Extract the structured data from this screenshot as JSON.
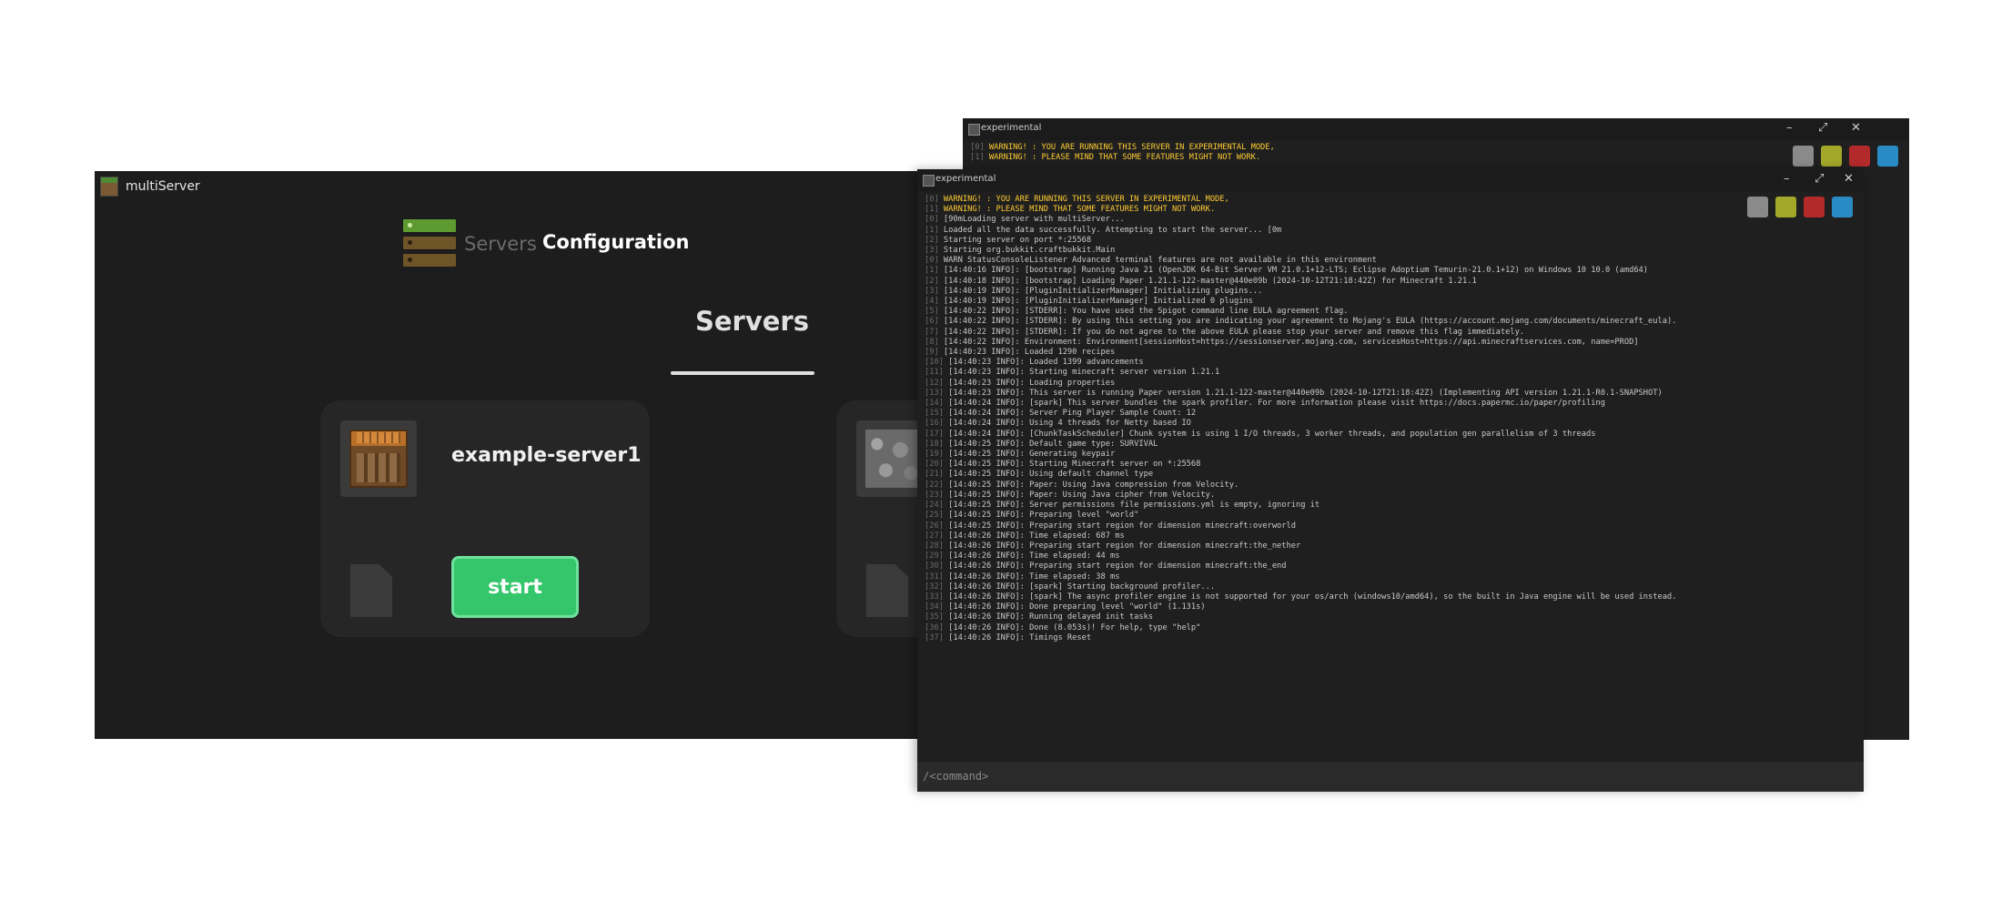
{
  "main_window": {
    "title": "multiServer",
    "nav": {
      "servers_label": "Servers",
      "configuration_label": "Configuration"
    },
    "section_title": "Servers",
    "servers": [
      {
        "name": "example-server1",
        "icon": "crafting-table-icon",
        "start_label": "start"
      },
      {
        "name": "",
        "icon": "cobblestone-icon"
      }
    ],
    "colors": {
      "accent_green": "#35c56b",
      "background": "#1d1d1d",
      "card": "#262626"
    }
  },
  "console_back": {
    "title": "experimental",
    "controls": {
      "minimize": "–",
      "maximize": "⤢",
      "close": "✕"
    },
    "swatches": [
      "#8a8a8a",
      "#a3a82a",
      "#b32a2a",
      "#2a8bc4"
    ],
    "lines": [
      {
        "idx": "[0]",
        "text": " WARNING! : YOU ARE RUNNING THIS SERVER IN EXPERIMENTAL MODE,",
        "warn": true
      },
      {
        "idx": "[1]",
        "text": " WARNING! : PLEASE MIND THAT SOME FEATURES MIGHT NOT WORK.",
        "warn": true
      }
    ]
  },
  "console_front": {
    "title": "experimental",
    "controls": {
      "minimize": "–",
      "maximize": "⤢",
      "close": "✕"
    },
    "swatches": [
      "#8a8a8a",
      "#a3a82a",
      "#b32a2a",
      "#2a8bc4"
    ],
    "command_placeholder": "/<command>",
    "lines": [
      {
        "idx": "[0]",
        "text": " WARNING! : YOU ARE RUNNING THIS SERVER IN EXPERIMENTAL MODE,",
        "warn": true
      },
      {
        "idx": "[1]",
        "text": " WARNING! : PLEASE MIND THAT SOME FEATURES MIGHT NOT WORK.",
        "warn": true
      },
      {
        "idx": "[0]",
        "text": " [90mLoading server with multiServer..."
      },
      {
        "idx": "[1]",
        "text": " Loaded all the data successfully. Attempting to start the server... [0m"
      },
      {
        "idx": "[2]",
        "text": " Starting server on port *:25568"
      },
      {
        "idx": "[3]",
        "text": " Starting org.bukkit.craftbukkit.Main"
      },
      {
        "idx": "[0]",
        "text": " WARN StatusConsoleListener Advanced terminal features are not available in this environment"
      },
      {
        "idx": "[1]",
        "text": " [14:40:16 INFO]: [bootstrap] Running Java 21 (OpenJDK 64-Bit Server VM 21.0.1+12-LTS; Eclipse Adoptium Temurin-21.0.1+12) on Windows 10 10.0 (amd64)"
      },
      {
        "idx": "[2]",
        "text": " [14:40:18 INFO]: [bootstrap] Loading Paper 1.21.1-122-master@440e09b (2024-10-12T21:18:42Z) for Minecraft 1.21.1"
      },
      {
        "idx": "[3]",
        "text": " [14:40:19 INFO]: [PluginInitializerManager] Initializing plugins..."
      },
      {
        "idx": "[4]",
        "text": " [14:40:19 INFO]: [PluginInitializerManager] Initialized 0 plugins"
      },
      {
        "idx": "[5]",
        "text": " [14:40:22 INFO]: [STDERR]: You have used the Spigot command line EULA agreement flag."
      },
      {
        "idx": "[6]",
        "text": " [14:40:22 INFO]: [STDERR]: By using this setting you are indicating your agreement to Mojang's EULA (https://account.mojang.com/documents/minecraft_eula)."
      },
      {
        "idx": "[7]",
        "text": " [14:40:22 INFO]: [STDERR]: If you do not agree to the above EULA please stop your server and remove this flag immediately."
      },
      {
        "idx": "[8]",
        "text": " [14:40:22 INFO]: Environment: Environment[sessionHost=https://sessionserver.mojang.com, servicesHost=https://api.minecraftservices.com, name=PROD]"
      },
      {
        "idx": "[9]",
        "text": " [14:40:23 INFO]: Loaded 1290 recipes"
      },
      {
        "idx": "[10]",
        "text": " [14:40:23 INFO]: Loaded 1399 advancements"
      },
      {
        "idx": "[11]",
        "text": " [14:40:23 INFO]: Starting minecraft server version 1.21.1"
      },
      {
        "idx": "[12]",
        "text": " [14:40:23 INFO]: Loading properties"
      },
      {
        "idx": "[13]",
        "text": " [14:40:23 INFO]: This server is running Paper version 1.21.1-122-master@440e09b (2024-10-12T21:18:42Z) (Implementing API version 1.21.1-R0.1-SNAPSHOT)"
      },
      {
        "idx": "[14]",
        "text": " [14:40:24 INFO]: [spark] This server bundles the spark profiler. For more information please visit https://docs.papermc.io/paper/profiling"
      },
      {
        "idx": "[15]",
        "text": " [14:40:24 INFO]: Server Ping Player Sample Count: 12"
      },
      {
        "idx": "[16]",
        "text": " [14:40:24 INFO]: Using 4 threads for Netty based IO"
      },
      {
        "idx": "[17]",
        "text": " [14:40:24 INFO]: [ChunkTaskScheduler] Chunk system is using 1 I/O threads, 3 worker threads, and population gen parallelism of 3 threads"
      },
      {
        "idx": "[18]",
        "text": " [14:40:25 INFO]: Default game type: SURVIVAL"
      },
      {
        "idx": "[19]",
        "text": " [14:40:25 INFO]: Generating keypair"
      },
      {
        "idx": "[20]",
        "text": " [14:40:25 INFO]: Starting Minecraft server on *:25568"
      },
      {
        "idx": "[21]",
        "text": " [14:40:25 INFO]: Using default channel type"
      },
      {
        "idx": "[22]",
        "text": " [14:40:25 INFO]: Paper: Using Java compression from Velocity."
      },
      {
        "idx": "[23]",
        "text": " [14:40:25 INFO]: Paper: Using Java cipher from Velocity."
      },
      {
        "idx": "[24]",
        "text": " [14:40:25 INFO]: Server permissions file permissions.yml is empty, ignoring it"
      },
      {
        "idx": "[25]",
        "text": " [14:40:25 INFO]: Preparing level \"world\""
      },
      {
        "idx": "[26]",
        "text": " [14:40:25 INFO]: Preparing start region for dimension minecraft:overworld"
      },
      {
        "idx": "[27]",
        "text": " [14:40:26 INFO]: Time elapsed: 687 ms"
      },
      {
        "idx": "[28]",
        "text": " [14:40:26 INFO]: Preparing start region for dimension minecraft:the_nether"
      },
      {
        "idx": "[29]",
        "text": " [14:40:26 INFO]: Time elapsed: 44 ms"
      },
      {
        "idx": "[30]",
        "text": " [14:40:26 INFO]: Preparing start region for dimension minecraft:the_end"
      },
      {
        "idx": "[31]",
        "text": " [14:40:26 INFO]: Time elapsed: 38 ms"
      },
      {
        "idx": "[32]",
        "text": " [14:40:26 INFO]: [spark] Starting background profiler..."
      },
      {
        "idx": "[33]",
        "text": " [14:40:26 INFO]: [spark] The async profiler engine is not supported for your os/arch (windows10/amd64), so the built in Java engine will be used instead."
      },
      {
        "idx": "[34]",
        "text": " [14:40:26 INFO]: Done preparing level \"world\" (1.131s)"
      },
      {
        "idx": "[35]",
        "text": " [14:40:26 INFO]: Running delayed init tasks"
      },
      {
        "idx": "[36]",
        "text": " [14:40:26 INFO]: Done (8.053s)! For help, type \"help\""
      },
      {
        "idx": "[37]",
        "text": " [14:40:26 INFO]: Timings Reset"
      }
    ]
  }
}
